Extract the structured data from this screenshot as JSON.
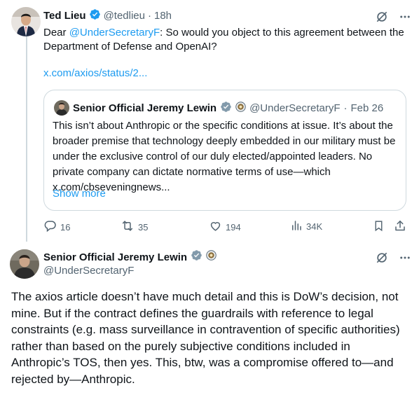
{
  "colors": {
    "accent": "#1d9bf0",
    "muted": "#536471",
    "border": "#cfd9de"
  },
  "tweet1": {
    "author_name": "Ted Lieu",
    "handle": "@tedlieu",
    "separator": "·",
    "time": "18h",
    "text_prefix": "Dear ",
    "mention": "@UnderSecretaryF",
    "text_body": ": So would you object to this agreement between the Department of Defense and OpenAI?",
    "link": "x.com/axios/status/2...",
    "quote": {
      "author_name": "Senior Official Jeremy Lewin",
      "handle": "@UnderSecretaryF",
      "separator": "·",
      "date": "Feb 26",
      "text": "This isn’t about Anthropic or the specific conditions at issue. It’s about the broader premise that technology deeply embedded in our military must be under the exclusive control of our duly elected/appointed leaders. No private company can dictate normative terms of use—which x.com/cbseveningnews...",
      "show_more": "Show more"
    },
    "actions": {
      "replies": "16",
      "retweets": "35",
      "likes": "194",
      "views": "34K"
    }
  },
  "tweet2": {
    "author_name": "Senior Official Jeremy Lewin",
    "handle": "@UnderSecretaryF",
    "text": "The axios article doesn’t have much detail and this is DoW’s decision, not mine. But if the contract defines the guardrails with reference to legal constraints (e.g. mass surveillance in contravention of specific authorities) rather than based on the purely subjective conditions included in Anthropic’s TOS, then yes. This, btw, was a compromise offered to—and rejected by—Anthropic."
  }
}
